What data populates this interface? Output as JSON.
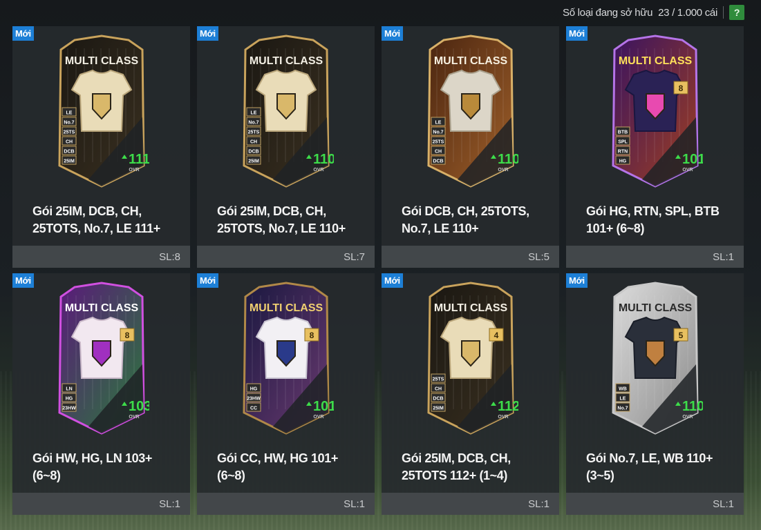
{
  "header": {
    "owned_label": "Số loại đang sở hữu",
    "owned_count": "23 / 1.000 cái",
    "help_label": "?"
  },
  "packs": [
    {
      "badge": "Mới",
      "title_line1": "Gói 25IM, DCB, CH,",
      "title_line2": "25TOTS, No.7, LE 111+",
      "quantity": "SL:8",
      "card_label": "MULTI CLASS",
      "ovr": "111",
      "ovr_label": "OVR",
      "level": "",
      "tags": [
        "LE",
        "No.7",
        "25TS",
        "CH",
        "DCB",
        "25IM"
      ],
      "theme": "gold"
    },
    {
      "badge": "Mới",
      "title_line1": "Gói 25IM, DCB, CH,",
      "title_line2": "25TOTS, No.7, LE 110+",
      "quantity": "SL:7",
      "card_label": "MULTI CLASS",
      "ovr": "110",
      "ovr_label": "OVR",
      "level": "",
      "tags": [
        "LE",
        "No.7",
        "25TS",
        "CH",
        "DCB",
        "25IM"
      ],
      "theme": "gold"
    },
    {
      "badge": "Mới",
      "title_line1": "Gói DCB, CH, 25TOTS,",
      "title_line2": "No.7, LE 110+",
      "quantity": "SL:5",
      "card_label": "MULTI CLASS",
      "ovr": "110",
      "ovr_label": "OVR",
      "level": "",
      "tags": [
        "LE",
        "No.7",
        "25TS",
        "CH",
        "DCB"
      ],
      "theme": "ornate"
    },
    {
      "badge": "Mới",
      "title_line1": "Gói HG, RTN, SPL, BTB",
      "title_line2": "101+ (6~8)",
      "quantity": "SL:1",
      "card_label": "MULTI CLASS",
      "ovr": "101",
      "ovr_label": "OVR",
      "level": "8",
      "tags": [
        "BTB",
        "SPL",
        "RTN",
        "HG"
      ],
      "theme": "purple"
    },
    {
      "badge": "Mới",
      "title_line1": "Gói HW, HG, LN 103+",
      "title_line2": "(6~8)",
      "quantity": "SL:1",
      "card_label": "MULTI CLASS",
      "ovr": "103",
      "ovr_label": "OVR",
      "level": "8",
      "tags": [
        "LN",
        "HG",
        "23HW"
      ],
      "theme": "neon"
    },
    {
      "badge": "Mới",
      "title_line1": "Gói CC, HW, HG 101+",
      "title_line2": "(6~8)",
      "quantity": "SL:1",
      "card_label": "MULTI CLASS",
      "ovr": "101",
      "ovr_label": "OVR",
      "level": "8",
      "tags": [
        "HG",
        "23HW",
        "CC"
      ],
      "theme": "navy"
    },
    {
      "badge": "Mới",
      "title_line1": "Gói 25IM, DCB, CH,",
      "title_line2": "25TOTS 112+ (1~4)",
      "quantity": "SL:1",
      "card_label": "MULTI CLASS",
      "ovr": "112",
      "ovr_label": "OVR",
      "level": "4",
      "tags": [
        "25TS",
        "CH",
        "DCB",
        "25IM"
      ],
      "theme": "gold"
    },
    {
      "badge": "Mới",
      "title_line1": "Gói No.7, LE, WB 110+",
      "title_line2": "(3~5)",
      "quantity": "SL:1",
      "card_label": "MULTI CLASS",
      "ovr": "110",
      "ovr_label": "OVR",
      "level": "5",
      "tags": [
        "WB",
        "LE",
        "No.7"
      ],
      "theme": "silver"
    }
  ],
  "colors": {
    "badge": "#1d7fd6",
    "ovr_green": "#3ddc4a",
    "help_green": "#2f8c3c"
  }
}
